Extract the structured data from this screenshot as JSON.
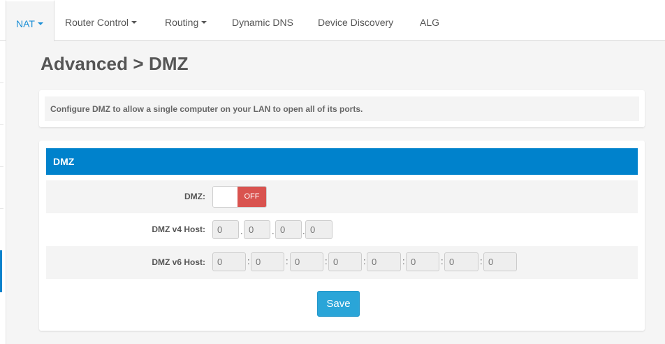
{
  "tabs": [
    {
      "label": "NAT",
      "has_dropdown": true,
      "active": true
    },
    {
      "label": "Router Control",
      "has_dropdown": true,
      "active": false
    },
    {
      "label": "Routing",
      "has_dropdown": true,
      "active": false
    },
    {
      "label": "Dynamic DNS",
      "has_dropdown": false,
      "active": false
    },
    {
      "label": "Device Discovery",
      "has_dropdown": false,
      "active": false
    },
    {
      "label": "ALG",
      "has_dropdown": false,
      "active": false
    }
  ],
  "page": {
    "title": "Advanced > DMZ"
  },
  "description": "Configure DMZ to allow a single computer on your LAN to open all of its ports.",
  "dmz_panel": {
    "header": "DMZ",
    "dmz_label": "DMZ:",
    "toggle_state": "OFF",
    "v4_label": "DMZ v4 Host:",
    "v4_placeholders": [
      "0",
      "0",
      "0",
      "0"
    ],
    "v6_label": "DMZ v6 Host:",
    "v6_placeholders": [
      "0",
      "0",
      "0",
      "0",
      "0",
      "0",
      "0",
      "0"
    ],
    "v4_separator": ".",
    "v6_separator": ":",
    "save_label": "Save"
  },
  "colors": {
    "accent": "#0082cc",
    "active_tab_text": "#1e90d6",
    "toggle_off": "#d9534f",
    "save_button": "#2aa5d8"
  }
}
